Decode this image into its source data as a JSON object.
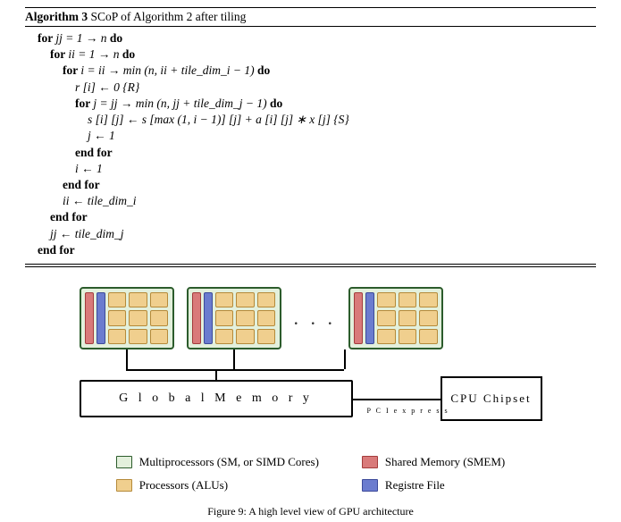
{
  "algorithm": {
    "number": "Algorithm 3",
    "title": "SCoP of Algorithm 2 after tiling",
    "lines": [
      {
        "indent": 1,
        "kw": "for ",
        "rest": "jj = 1 → n",
        "tail": " do"
      },
      {
        "indent": 2,
        "kw": "for ",
        "rest": "ii = 1 → n",
        "tail": " do"
      },
      {
        "indent": 3,
        "kw": "for ",
        "rest": "i = ii → min (n, ii + tile_dim_i − 1)",
        "tail": " do"
      },
      {
        "indent": 4,
        "kw": "",
        "rest": "r [i] ← 0 {R}",
        "tail": ""
      },
      {
        "indent": 4,
        "kw": "for ",
        "rest": "j = jj → min (n, jj + tile_dim_j − 1)",
        "tail": " do"
      },
      {
        "indent": 5,
        "kw": "",
        "rest": "s [i] [j] ← s [max (1, i − 1)] [j] + a [i] [j] ∗ x [j]  {S}",
        "tail": ""
      },
      {
        "indent": 5,
        "kw": "",
        "rest": "j ← 1",
        "tail": ""
      },
      {
        "indent": 4,
        "kw": "end for",
        "rest": "",
        "tail": ""
      },
      {
        "indent": 4,
        "kw": "",
        "rest": "i ← 1",
        "tail": ""
      },
      {
        "indent": 3,
        "kw": "end for",
        "rest": "",
        "tail": ""
      },
      {
        "indent": 3,
        "kw": "",
        "rest": "ii ← tile_dim_i",
        "tail": ""
      },
      {
        "indent": 2,
        "kw": "end for",
        "rest": "",
        "tail": ""
      },
      {
        "indent": 2,
        "kw": "",
        "rest": "jj ← tile_dim_j",
        "tail": ""
      },
      {
        "indent": 1,
        "kw": "end for",
        "rest": "",
        "tail": ""
      }
    ]
  },
  "diagram": {
    "global_memory_label": "G l o b a l   M e m o r y",
    "pci_label": "P C I e x p r e s s",
    "cpu_label": "CPU Chipset",
    "dots": ". . ."
  },
  "legend": {
    "sm": "Multiprocessors (SM, or SIMD Cores)",
    "alu": "Processors (ALUs)",
    "smem": "Shared Memory (SMEM)",
    "rf": "Registre File"
  },
  "caption": "Figure 9: A high level view of GPU architecture"
}
